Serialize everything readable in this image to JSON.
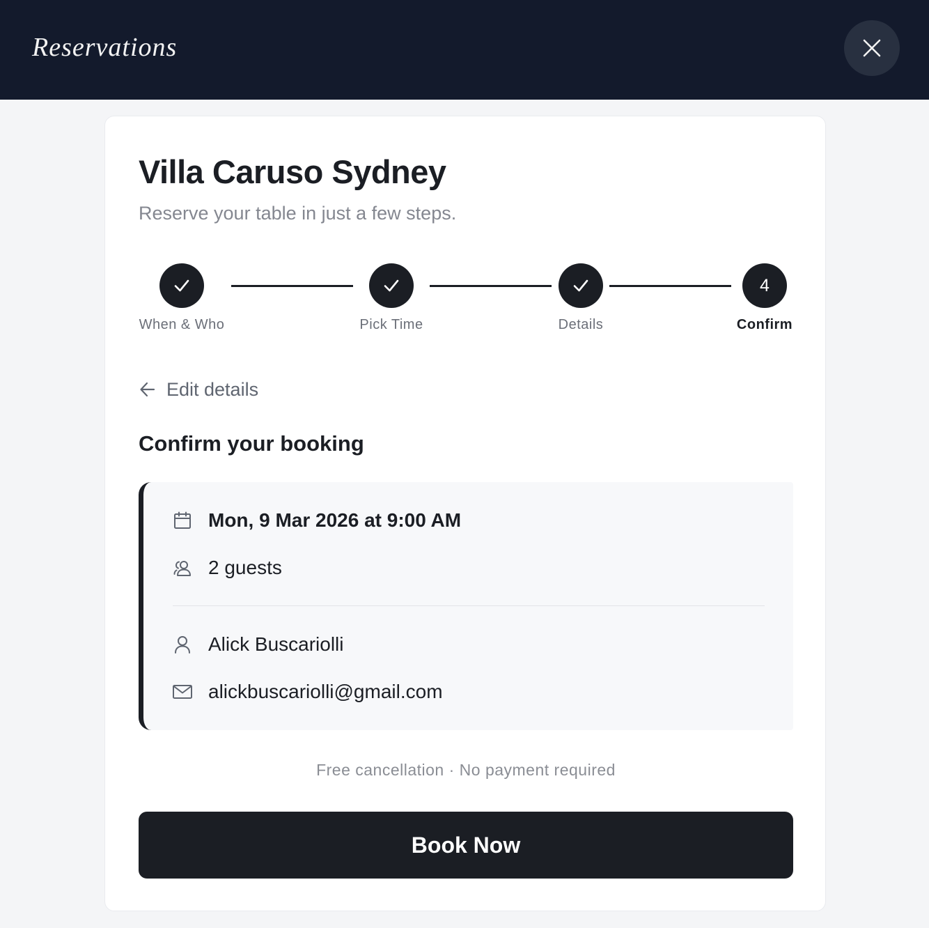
{
  "header": {
    "brand": "Reservations",
    "close_icon": "close-icon"
  },
  "restaurant": {
    "name": "Villa Caruso Sydney",
    "tagline": "Reserve your table in just a few steps."
  },
  "stepper": {
    "steps": [
      {
        "label": "When & Who",
        "state": "done",
        "icon": "check-icon"
      },
      {
        "label": "Pick Time",
        "state": "done",
        "icon": "check-icon"
      },
      {
        "label": "Details",
        "state": "done",
        "icon": "check-icon"
      },
      {
        "label": "Confirm",
        "state": "current",
        "number": "4"
      }
    ]
  },
  "back_link": {
    "label": "Edit details",
    "icon": "arrow-left-icon"
  },
  "section_heading": "Confirm your booking",
  "summary": {
    "datetime": "Mon, 9 Mar 2026 at 9:00 AM",
    "guests": "2 guests",
    "name": "Alick Buscariolli",
    "email": "alickbuscariolli@gmail.com",
    "icons": {
      "datetime": "calendar-icon",
      "guests": "users-icon",
      "name": "user-icon",
      "email": "mail-icon"
    }
  },
  "note": "Free cancellation · No payment required",
  "cta": {
    "label": "Book Now"
  },
  "colors": {
    "header_bg": "#131a2c",
    "primary": "#1b1e24",
    "page_bg": "#f4f5f7",
    "muted_text": "#848790"
  }
}
